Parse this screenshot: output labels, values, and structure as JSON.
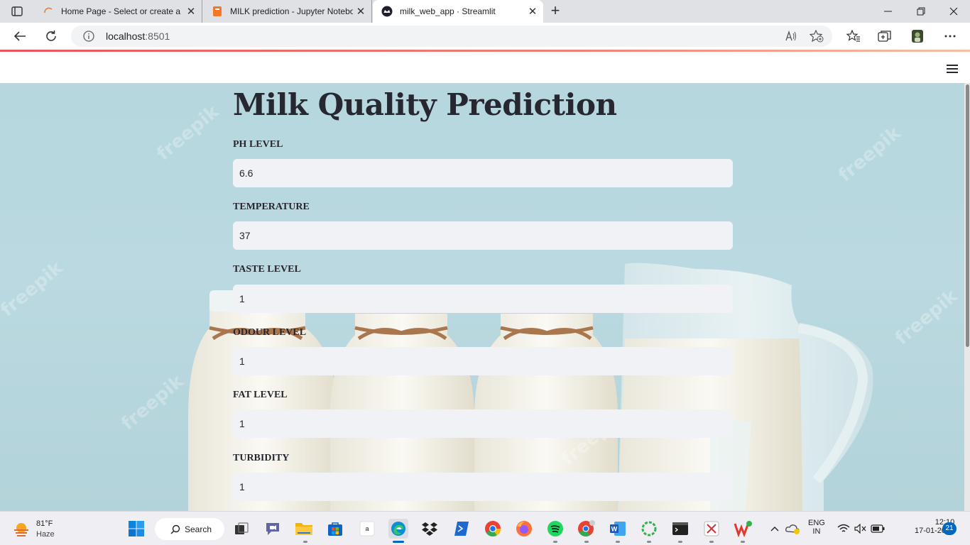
{
  "browser": {
    "tabs": [
      {
        "title": "Home Page - Select or create a n",
        "favicon": "jupyter-spinner-icon",
        "active": false
      },
      {
        "title": "MILK prediction - Jupyter Notebo",
        "favicon": "jupyter-book-icon",
        "active": false
      },
      {
        "title": "milk_web_app · Streamlit",
        "favicon": "streamlit-crown-icon",
        "active": true
      }
    ],
    "close_glyph": "✕",
    "new_tab_glyph": "+",
    "address": {
      "host": "localhost",
      "port": ":8501"
    },
    "colors": {
      "progress_start": "#e8555e",
      "progress_end": "#f7c0a6"
    }
  },
  "app": {
    "title": "Milk Quality Prediction",
    "fields": [
      {
        "label": "PH LEVEL",
        "value": "6.6"
      },
      {
        "label": "TEMPERATURE",
        "value": "37"
      },
      {
        "label": "TASTE LEVEL",
        "value": "1"
      },
      {
        "label": "ODOUR LEVEL",
        "value": "1"
      },
      {
        "label": "FAT LEVEL",
        "value": "1"
      },
      {
        "label": "TURBIDITY",
        "value": "1"
      }
    ],
    "watermark": "freepik",
    "colors": {
      "text": "#262730",
      "input_bg": "#f0f2f6",
      "background": "#b6d7de"
    }
  },
  "taskbar": {
    "weather": {
      "temp": "81°F",
      "condition": "Haze"
    },
    "search_label": "Search",
    "language": {
      "top": "ENG",
      "bottom": "IN"
    },
    "clock": {
      "time": "12:10",
      "date": "17-01-2023"
    },
    "notification_count": "21",
    "apps": [
      "task-view-icon",
      "teams-meet-icon",
      "file-explorer-icon",
      "microsoft-store-icon",
      "amazon-icon",
      "edge-icon",
      "dropbox-icon",
      "powershell-icon",
      "chrome-icon",
      "firefox-icon",
      "spotify-icon",
      "chrome-dev-icon",
      "word-icon",
      "spinner-app-icon",
      "terminal-icon",
      "snipping-tool-icon",
      "wps-office-icon"
    ]
  }
}
